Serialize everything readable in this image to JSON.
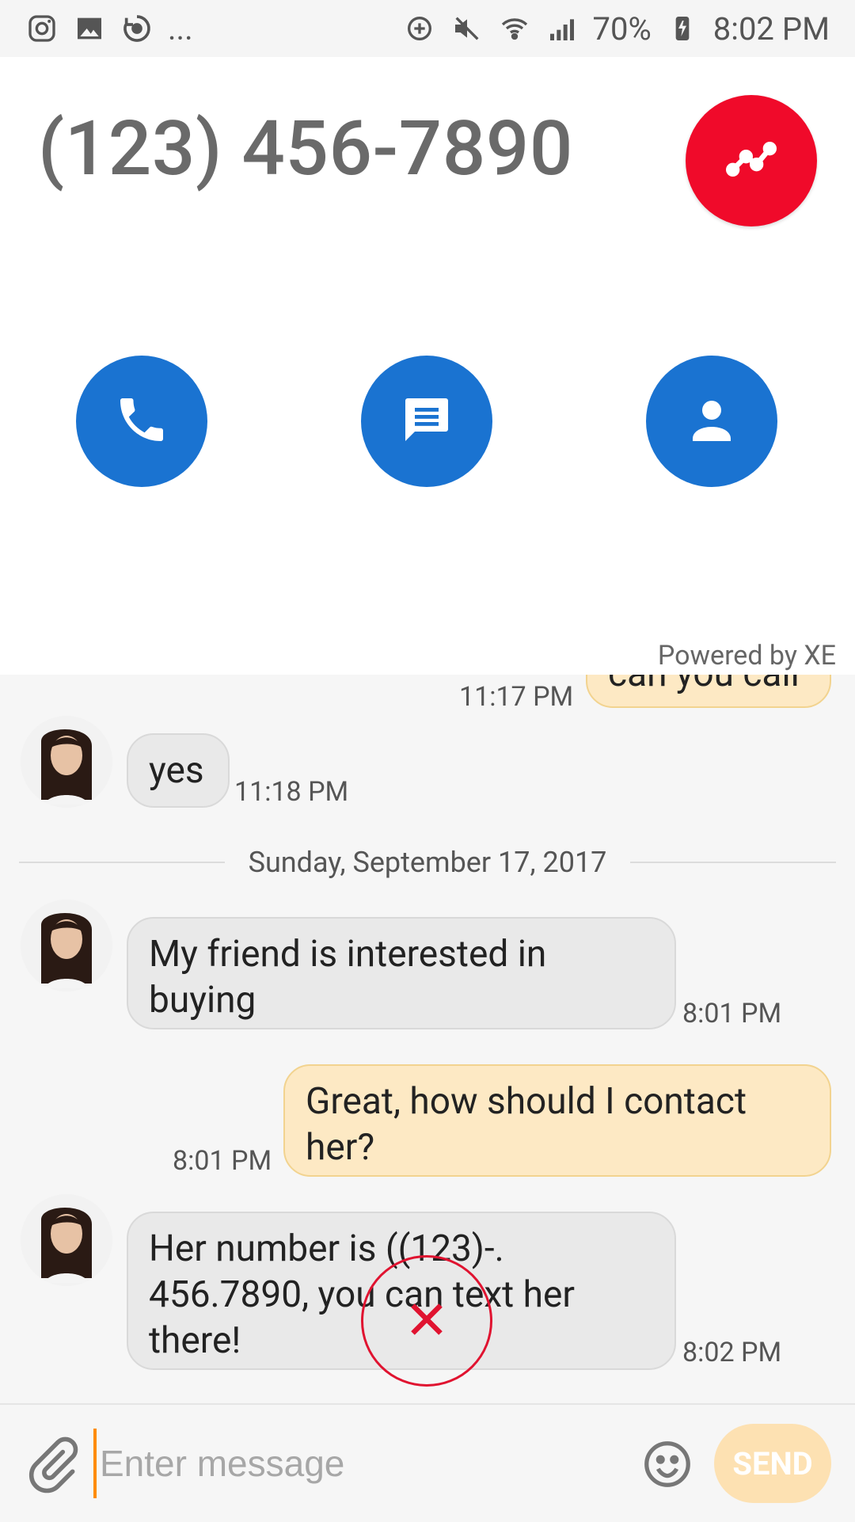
{
  "status_bar": {
    "left_icons": [
      "instagram-icon",
      "gallery-icon",
      "sync-icon",
      "more-dots"
    ],
    "more_text": "...",
    "battery_text": "70%",
    "time_text": "8:02 PM"
  },
  "contact_panel": {
    "phone_number": "(123) 456-7890",
    "powered_by": "Powered by XE",
    "actions": [
      "call-icon",
      "message-icon",
      "contact-icon"
    ],
    "trend_button_icon": "trend-icon",
    "colors": {
      "trend_bg": "#f00a2a",
      "action_bg": "#1a73d1"
    }
  },
  "chat": {
    "partial_time": "11:17 PM",
    "partial_text": "can you call",
    "date_separator": "Sunday, September 17, 2017",
    "messages": [
      {
        "side": "in",
        "text": "yes",
        "time": "11:18 PM"
      },
      {
        "side": "in",
        "text": "My friend is interested in buying",
        "time": "8:01 PM"
      },
      {
        "side": "out",
        "text": "Great, how should I contact her?",
        "time": "8:01 PM"
      },
      {
        "side": "in",
        "text": "Her number is ((123)-. 456.7890, you can text her there!",
        "time": "8:02 PM"
      }
    ]
  },
  "composer": {
    "placeholder": "Enter message",
    "send_label": "SEND",
    "attach_icon": "paperclip-icon",
    "emoji_icon": "smiley-icon"
  }
}
